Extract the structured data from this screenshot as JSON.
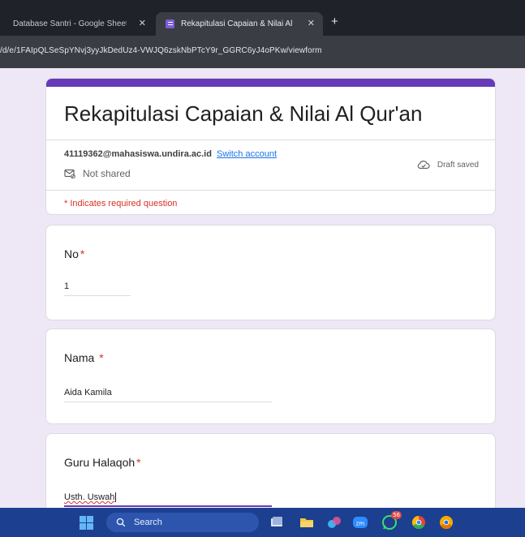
{
  "browser": {
    "tabs": [
      {
        "label": "Database Santri - Google Sheet"
      },
      {
        "label": "Rekapitulasi Capaian & Nilai Al Qur'an",
        "active": true
      }
    ],
    "url": "/d/e/1FAIpQLSeSpYNvj3yyJkDedUz4-VWJQ6zskNbPTcY9r_GGRC6yJ4oPKw/viewform"
  },
  "form": {
    "title": "Rekapitulasi Capaian & Nilai Al Qur'an",
    "account_email": "41119362@mahasiswa.undira.ac.id",
    "switch_account": "Switch account",
    "not_shared": "Not shared",
    "draft_status": "Draft saved",
    "required_note": "* Indicates required question",
    "accent_color": "#673ab7",
    "questions": [
      {
        "label": "No",
        "value": "1"
      },
      {
        "label": "Nama",
        "value": "Aida Kamila"
      },
      {
        "label": "Guru Halaqoh",
        "value": "Usth. Uswah"
      }
    ]
  },
  "taskbar": {
    "search_placeholder": "Search",
    "whatsapp_badge": "56",
    "icons": [
      "windows-start-icon",
      "search-icon",
      "task-view-icon",
      "file-explorer-icon",
      "photos-icon",
      "zoom-icon",
      "whatsapp-icon",
      "chrome-icon",
      "chrome-canary-icon"
    ]
  }
}
